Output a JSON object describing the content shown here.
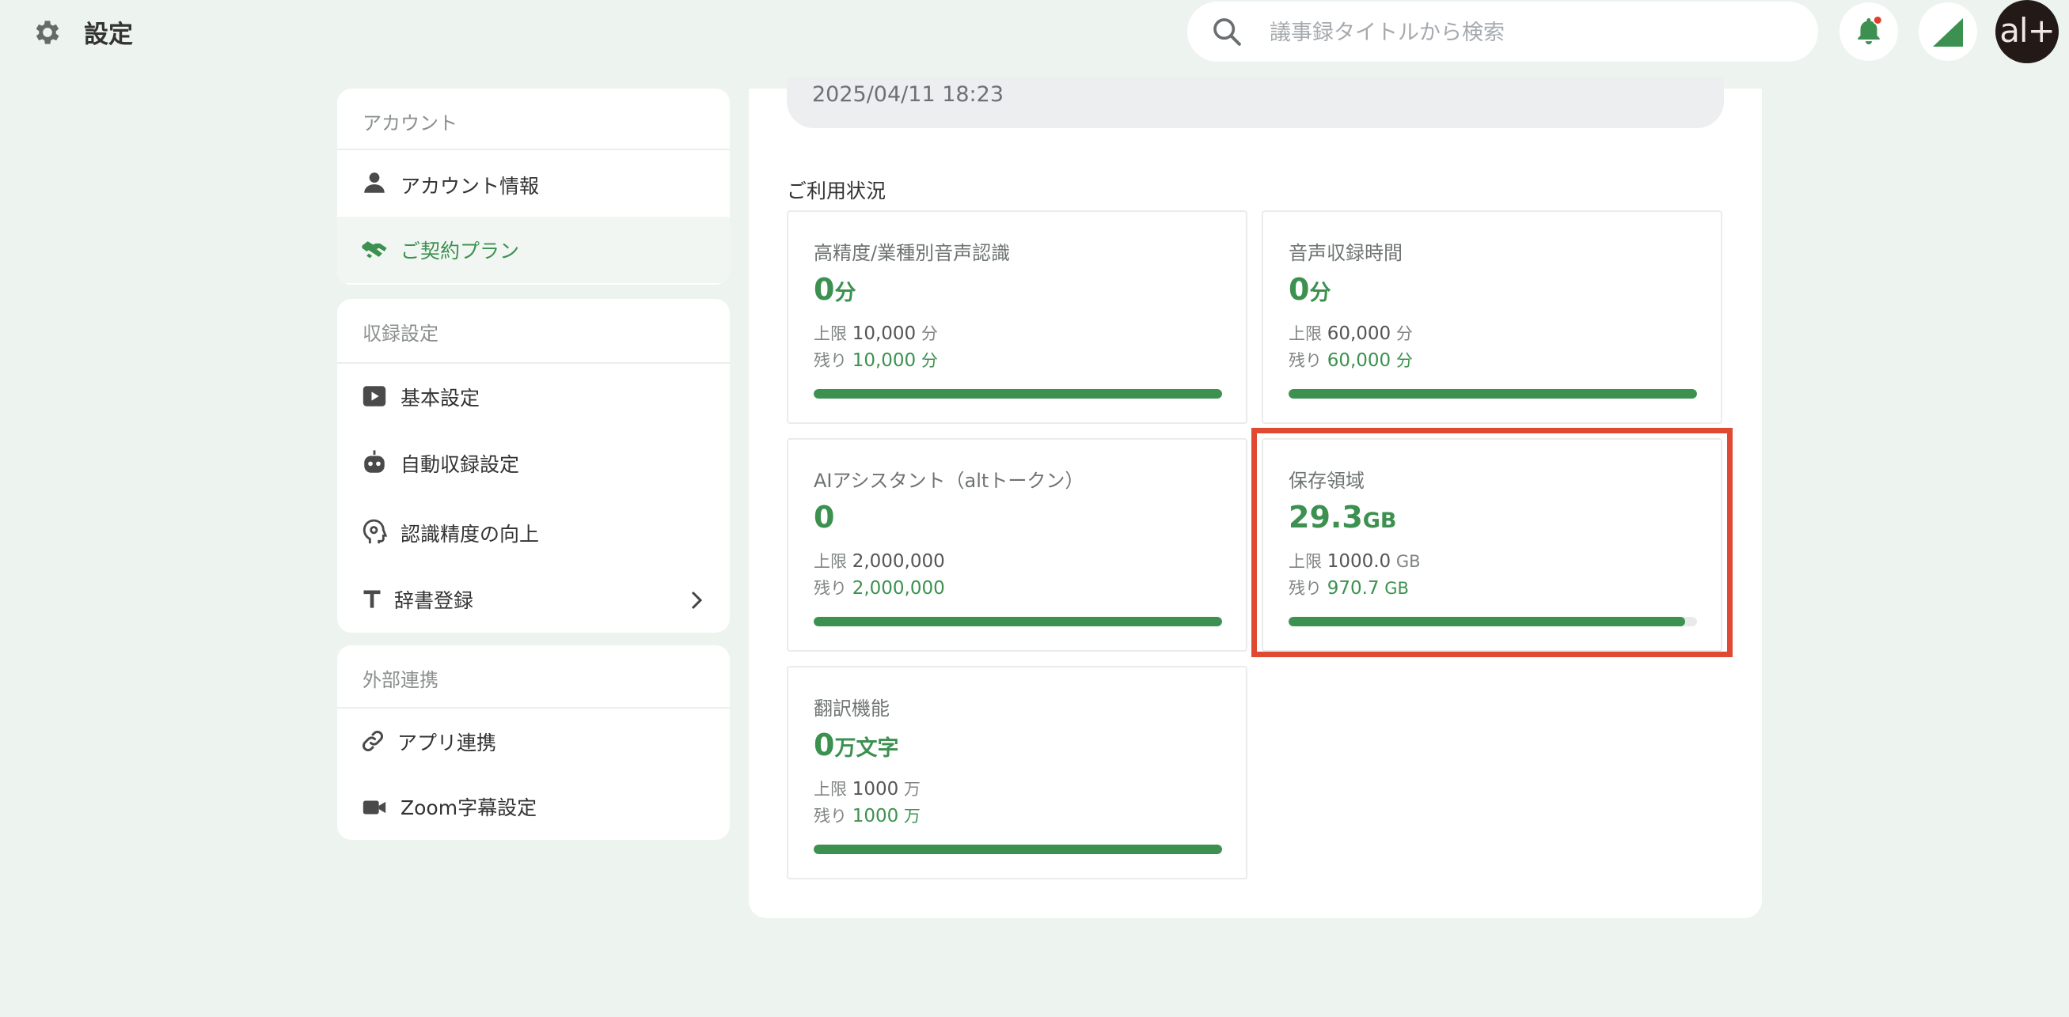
{
  "header": {
    "title": "設定",
    "search_placeholder": "議事録タイトルから検索",
    "avatar_text": "al+",
    "colors": {
      "brand": "#3c9150",
      "notification_dot": "#e0402a",
      "avatar_bg": "#231a18"
    }
  },
  "sidebar": {
    "account": {
      "heading": "アカウント",
      "items": [
        {
          "label": "アカウント情報",
          "icon": "person-icon"
        },
        {
          "label": "ご契約プラン",
          "icon": "handshake-icon",
          "active": true
        }
      ]
    },
    "recording": {
      "heading": "収録設定",
      "items": [
        {
          "label": "基本設定",
          "icon": "play-icon"
        },
        {
          "label": "自動収録設定",
          "icon": "robot-icon"
        },
        {
          "label": "認識精度の向上",
          "icon": "head-gear-icon"
        },
        {
          "label": "辞書登録",
          "icon": "text-t-icon"
        }
      ]
    },
    "external": {
      "heading": "外部連携",
      "items": [
        {
          "label": "アプリ連携",
          "icon": "link-icon"
        },
        {
          "label": "Zoom字幕設定",
          "icon": "video-camera-icon"
        }
      ]
    }
  },
  "main": {
    "date": "2025/04/11 18:23",
    "usage_title": "ご利用状況",
    "limit_label": "上限",
    "remain_label": "残り",
    "cards": [
      {
        "title": "高精度/業種別音声認識",
        "value": "0",
        "unit": "分",
        "limit": "10,000",
        "limit_unit": "分",
        "remain": "10,000",
        "remain_unit": "分",
        "remaining_fraction": 1.0
      },
      {
        "title": "音声収録時間",
        "value": "0",
        "unit": "分",
        "limit": "60,000",
        "limit_unit": "分",
        "remain": "60,000",
        "remain_unit": "分",
        "remaining_fraction": 1.0
      },
      {
        "title": "AIアシスタント（altトークン）",
        "value": "0",
        "unit": "",
        "limit": "2,000,000",
        "limit_unit": "",
        "remain": "2,000,000",
        "remain_unit": "",
        "remaining_fraction": 1.0
      },
      {
        "title": "保存領域",
        "value": "29.3",
        "unit": "GB",
        "limit": "1000.0",
        "limit_unit": "GB",
        "remain": "970.7",
        "remain_unit": "GB",
        "remaining_fraction": 0.9707
      },
      {
        "title": "翻訳機能",
        "value": "0",
        "unit": "万文字",
        "limit": "1000",
        "limit_unit": "万",
        "remain": "1000",
        "remain_unit": "万",
        "remaining_fraction": 1.0
      }
    ],
    "highlighted_card": "保存領域"
  }
}
